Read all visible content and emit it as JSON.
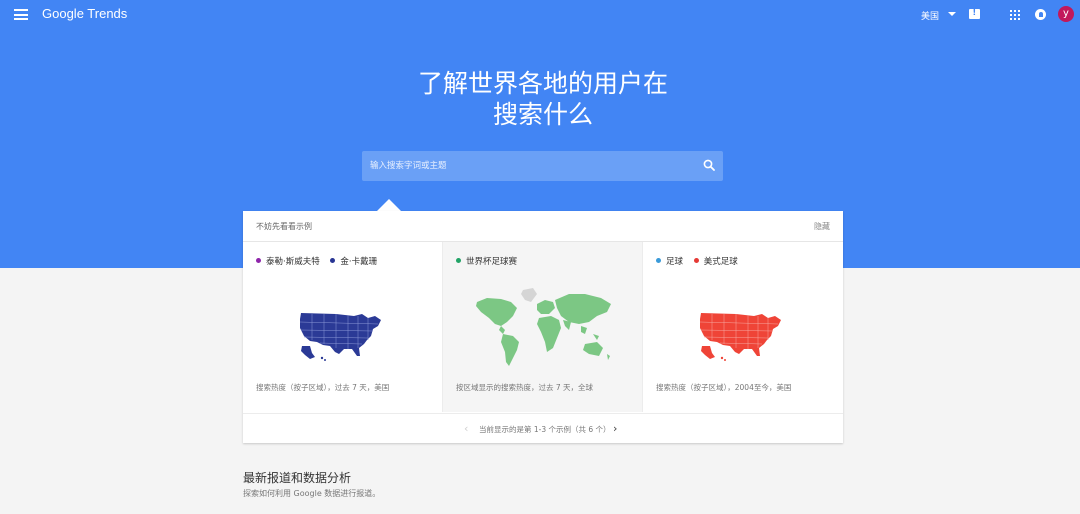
{
  "header": {
    "logo": "Google Trends",
    "region": "美国",
    "avatar_letter": "y"
  },
  "hero": {
    "line1": "了解世界各地的用户在",
    "line2": "搜索什么",
    "search_placeholder": "输入搜索字词或主题"
  },
  "examples_card": {
    "title": "不妨先看看示例",
    "hide_label": "隐藏",
    "items": [
      {
        "terms": [
          {
            "label": "泰勒·斯威夫特",
            "color": "#8e24aa"
          },
          {
            "label": "金·卡戴珊",
            "color": "#283593"
          }
        ],
        "map_color": "#2b3a96",
        "caption": "搜索热度（按子区域），过去 7 天，美国"
      },
      {
        "terms": [
          {
            "label": "世界杯足球赛",
            "color": "#21a366"
          }
        ],
        "map_color": "#7cc784",
        "caption": "按区域显示的搜索热度，过去 7 天，全球"
      },
      {
        "terms": [
          {
            "label": "足球",
            "color": "#3a9ad9"
          },
          {
            "label": "美式足球",
            "color": "#e53935"
          }
        ],
        "map_color": "#ef4437",
        "caption": "搜索热度（按子区域），2004至今，美国"
      }
    ],
    "pager": {
      "prev_symbol": "‹",
      "text": "当前显示的是第 1-3 个示例（共 6 个）",
      "next_symbol": "›"
    }
  },
  "news": {
    "title": "最新报道和数据分析",
    "subtitle": "探索如何利用 Google 数据进行报道。"
  }
}
